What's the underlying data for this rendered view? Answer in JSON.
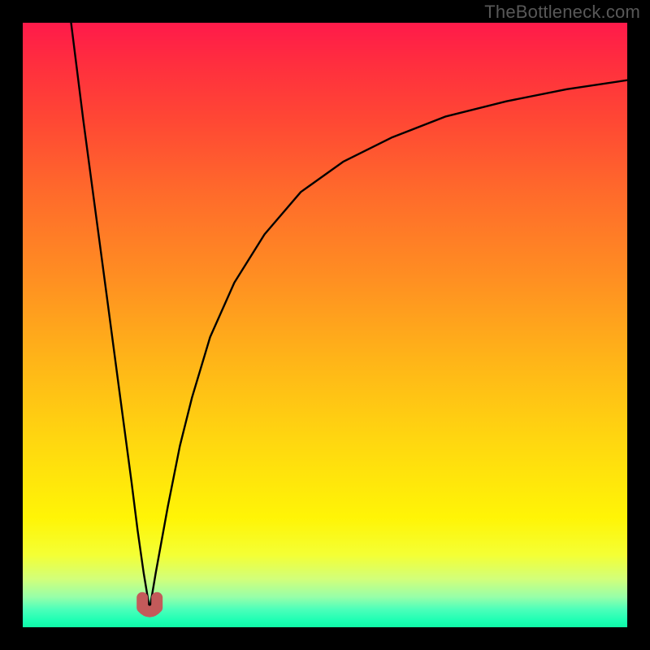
{
  "watermark": "TheBottleneck.com",
  "chart_data": {
    "type": "line",
    "title": "",
    "xlabel": "",
    "ylabel": "",
    "xlim": [
      0,
      100
    ],
    "ylim": [
      0,
      100
    ],
    "grid": false,
    "marker": {
      "x": 21,
      "y": 3,
      "color": "#c35a5a",
      "shape": "u"
    },
    "series": [
      {
        "name": "left-branch",
        "x": [
          8,
          10,
          12,
          14,
          16,
          18,
          19,
          20,
          21
        ],
        "values": [
          100,
          84,
          69,
          54,
          39,
          24,
          16,
          9,
          3
        ]
      },
      {
        "name": "right-branch",
        "x": [
          21,
          22,
          24,
          26,
          28,
          31,
          35,
          40,
          46,
          53,
          61,
          70,
          80,
          90,
          100
        ],
        "values": [
          3,
          9,
          20,
          30,
          38,
          48,
          57,
          65,
          72,
          77,
          81,
          84.5,
          87,
          89,
          90.5
        ]
      }
    ],
    "gradient_stops": [
      {
        "pct": 0,
        "color": "#ff1a4a"
      },
      {
        "pct": 7,
        "color": "#ff2f3e"
      },
      {
        "pct": 16,
        "color": "#ff4734"
      },
      {
        "pct": 28,
        "color": "#ff6a2b"
      },
      {
        "pct": 42,
        "color": "#ff8e22"
      },
      {
        "pct": 56,
        "color": "#ffb518"
      },
      {
        "pct": 70,
        "color": "#ffd90f"
      },
      {
        "pct": 82,
        "color": "#fff506"
      },
      {
        "pct": 88,
        "color": "#f4ff34"
      },
      {
        "pct": 92,
        "color": "#d2ff7a"
      },
      {
        "pct": 95,
        "color": "#97ffa9"
      },
      {
        "pct": 97,
        "color": "#4dffba"
      },
      {
        "pct": 99,
        "color": "#1affb3"
      },
      {
        "pct": 100,
        "color": "#10f7a7"
      }
    ]
  }
}
